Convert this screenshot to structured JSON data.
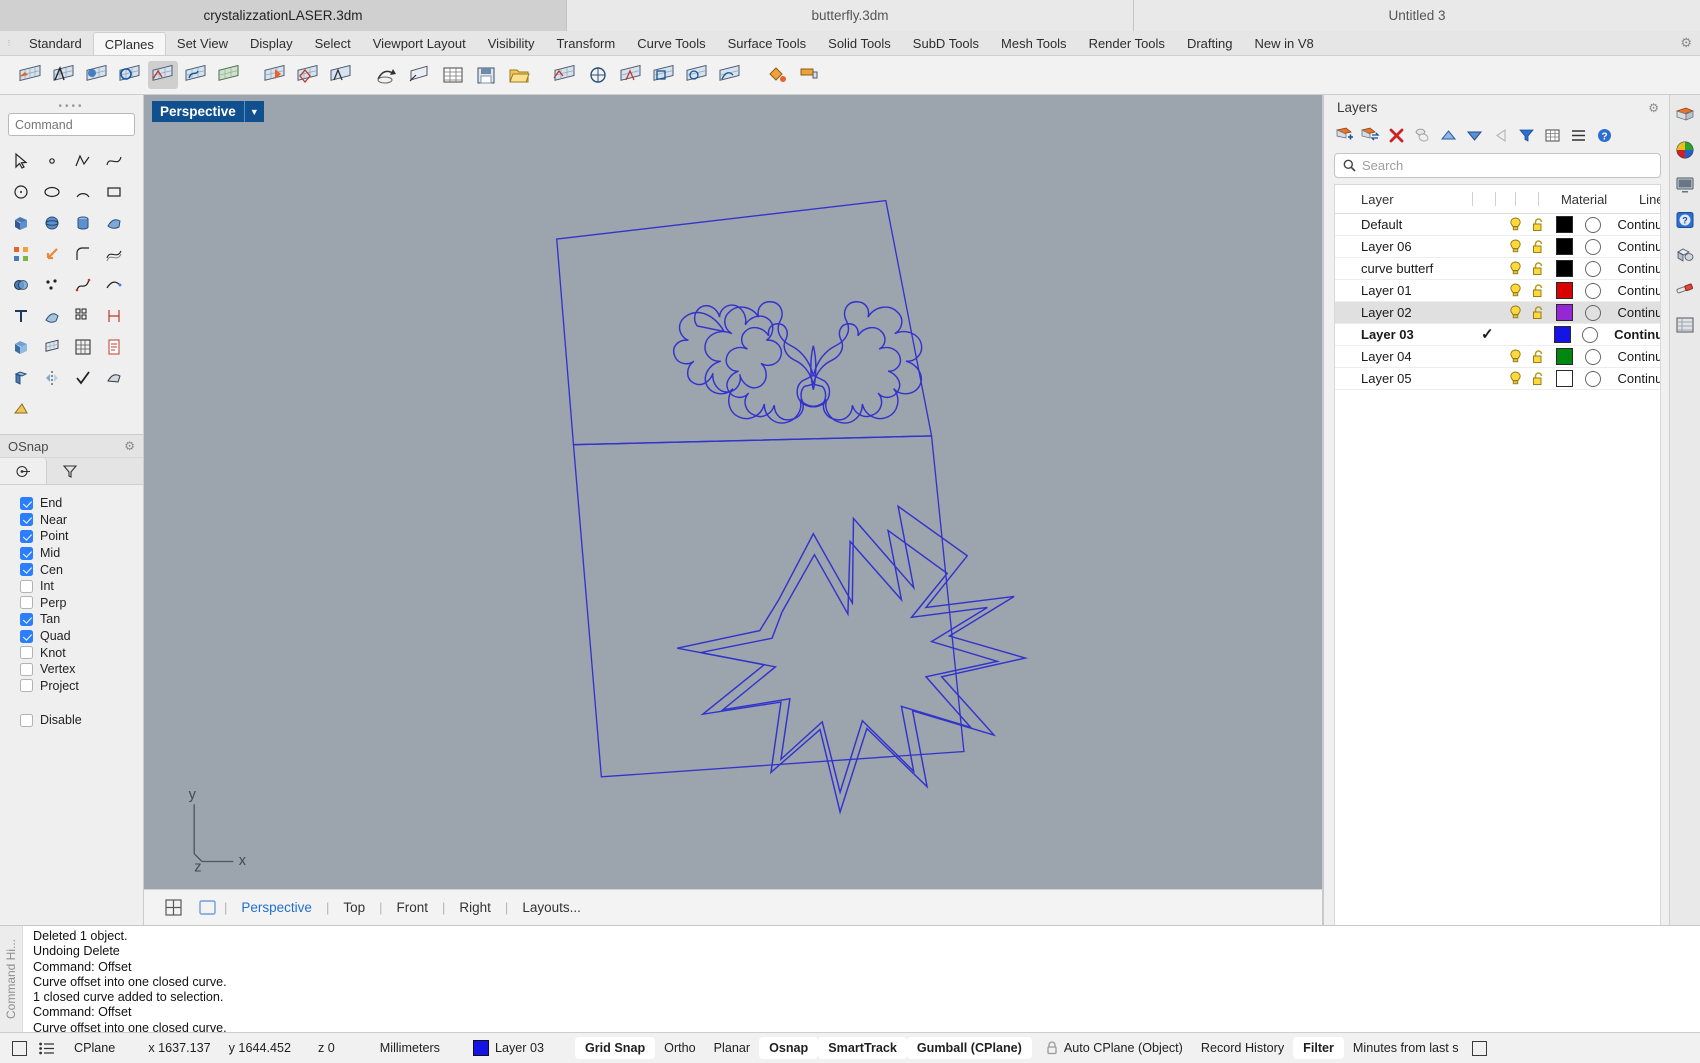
{
  "titlebar": {
    "tabs": [
      {
        "label": "crystalizzationLASER.3dm",
        "active": true
      },
      {
        "label": "butterfly.3dm",
        "active": false
      },
      {
        "label": "Untitled 3",
        "active": false
      }
    ]
  },
  "ribbon_tabs": [
    {
      "label": "Standard",
      "selected": false
    },
    {
      "label": "CPlanes",
      "selected": true
    },
    {
      "label": "Set View",
      "selected": false
    },
    {
      "label": "Display",
      "selected": false
    },
    {
      "label": "Select",
      "selected": false
    },
    {
      "label": "Viewport Layout",
      "selected": false
    },
    {
      "label": "Visibility",
      "selected": false
    },
    {
      "label": "Transform",
      "selected": false
    },
    {
      "label": "Curve Tools",
      "selected": false
    },
    {
      "label": "Surface Tools",
      "selected": false
    },
    {
      "label": "Solid Tools",
      "selected": false
    },
    {
      "label": "SubD Tools",
      "selected": false
    },
    {
      "label": "Mesh Tools",
      "selected": false
    },
    {
      "label": "Render Tools",
      "selected": false
    },
    {
      "label": "Drafting",
      "selected": false
    },
    {
      "label": "New in V8",
      "selected": false
    }
  ],
  "command": {
    "placeholder": "Command"
  },
  "osnap": {
    "title": "OSnap",
    "items": [
      {
        "label": "End",
        "checked": true
      },
      {
        "label": "Near",
        "checked": true
      },
      {
        "label": "Point",
        "checked": true
      },
      {
        "label": "Mid",
        "checked": true
      },
      {
        "label": "Cen",
        "checked": true
      },
      {
        "label": "Int",
        "checked": false
      },
      {
        "label": "Perp",
        "checked": false
      },
      {
        "label": "Tan",
        "checked": true
      },
      {
        "label": "Quad",
        "checked": true
      },
      {
        "label": "Knot",
        "checked": false
      },
      {
        "label": "Vertex",
        "checked": false
      },
      {
        "label": "Project",
        "checked": false
      }
    ],
    "disable": {
      "label": "Disable",
      "checked": false
    }
  },
  "viewport": {
    "label": "Perspective",
    "axes": {
      "x": "x",
      "y": "y",
      "z": "z"
    },
    "tabs": [
      {
        "label": "Perspective",
        "active": true
      },
      {
        "label": "Top",
        "active": false
      },
      {
        "label": "Front",
        "active": false
      },
      {
        "label": "Right",
        "active": false
      },
      {
        "label": "Layouts...",
        "active": false
      }
    ]
  },
  "layers_panel": {
    "title": "Layers",
    "search_placeholder": "Search",
    "columns": [
      "Layer",
      "Material",
      "Linetyp"
    ],
    "rows": [
      {
        "name": "Default",
        "on": true,
        "unlocked": true,
        "color": "#000000",
        "linetype": "Continu",
        "selected": false,
        "current": false
      },
      {
        "name": "Layer 06",
        "on": true,
        "unlocked": true,
        "color": "#000000",
        "linetype": "Continu",
        "selected": false,
        "current": false
      },
      {
        "name": "curve butterf",
        "on": true,
        "unlocked": true,
        "color": "#000000",
        "linetype": "Continu",
        "selected": false,
        "current": false
      },
      {
        "name": "Layer 01",
        "on": true,
        "unlocked": true,
        "color": "#d90000",
        "linetype": "Continu",
        "selected": false,
        "current": false
      },
      {
        "name": "Layer 02",
        "on": true,
        "unlocked": true,
        "color": "#9627d4",
        "linetype": "Continu",
        "selected": true,
        "current": false
      },
      {
        "name": "Layer 03",
        "on": true,
        "unlocked": true,
        "color": "#1414e6",
        "linetype": "Continu",
        "selected": false,
        "current": true
      },
      {
        "name": "Layer 04",
        "on": true,
        "unlocked": true,
        "color": "#00870f",
        "linetype": "Continu",
        "selected": false,
        "current": false
      },
      {
        "name": "Layer 05",
        "on": true,
        "unlocked": true,
        "color": "#ffffff",
        "linetype": "Continu",
        "selected": false,
        "current": false
      }
    ]
  },
  "command_history": {
    "label": "Command Hi...",
    "lines": [
      "Deleted 1 object.",
      "Undoing Delete",
      "Command: Offset",
      "Curve offset into one closed curve.",
      "1 closed curve added to selection.",
      "Command: Offset",
      "Curve offset into one closed curve."
    ]
  },
  "statusbar": {
    "cplane": "CPlane",
    "x": "x 1637.137",
    "y": "y 1644.452",
    "z": "z 0",
    "units": "Millimeters",
    "layer": "Layer 03",
    "layer_color": "#1414e6",
    "toggles": [
      {
        "label": "Grid Snap",
        "active": true
      },
      {
        "label": "Ortho",
        "active": false
      },
      {
        "label": "Planar",
        "active": false
      },
      {
        "label": "Osnap",
        "active": true
      },
      {
        "label": "SmartTrack",
        "active": true
      },
      {
        "label": "Gumball (CPlane)",
        "active": true
      }
    ],
    "auto_cplane": "Auto CPlane (Object)",
    "record_history": "Record History",
    "filter": "Filter",
    "minutes": "Minutes from last s"
  },
  "colors": {
    "viewport_bg": "#9ca4ae",
    "curve_blue": "#3333cc",
    "accent_blue": "#10508f",
    "selection_gray": "#e0e0e0"
  }
}
